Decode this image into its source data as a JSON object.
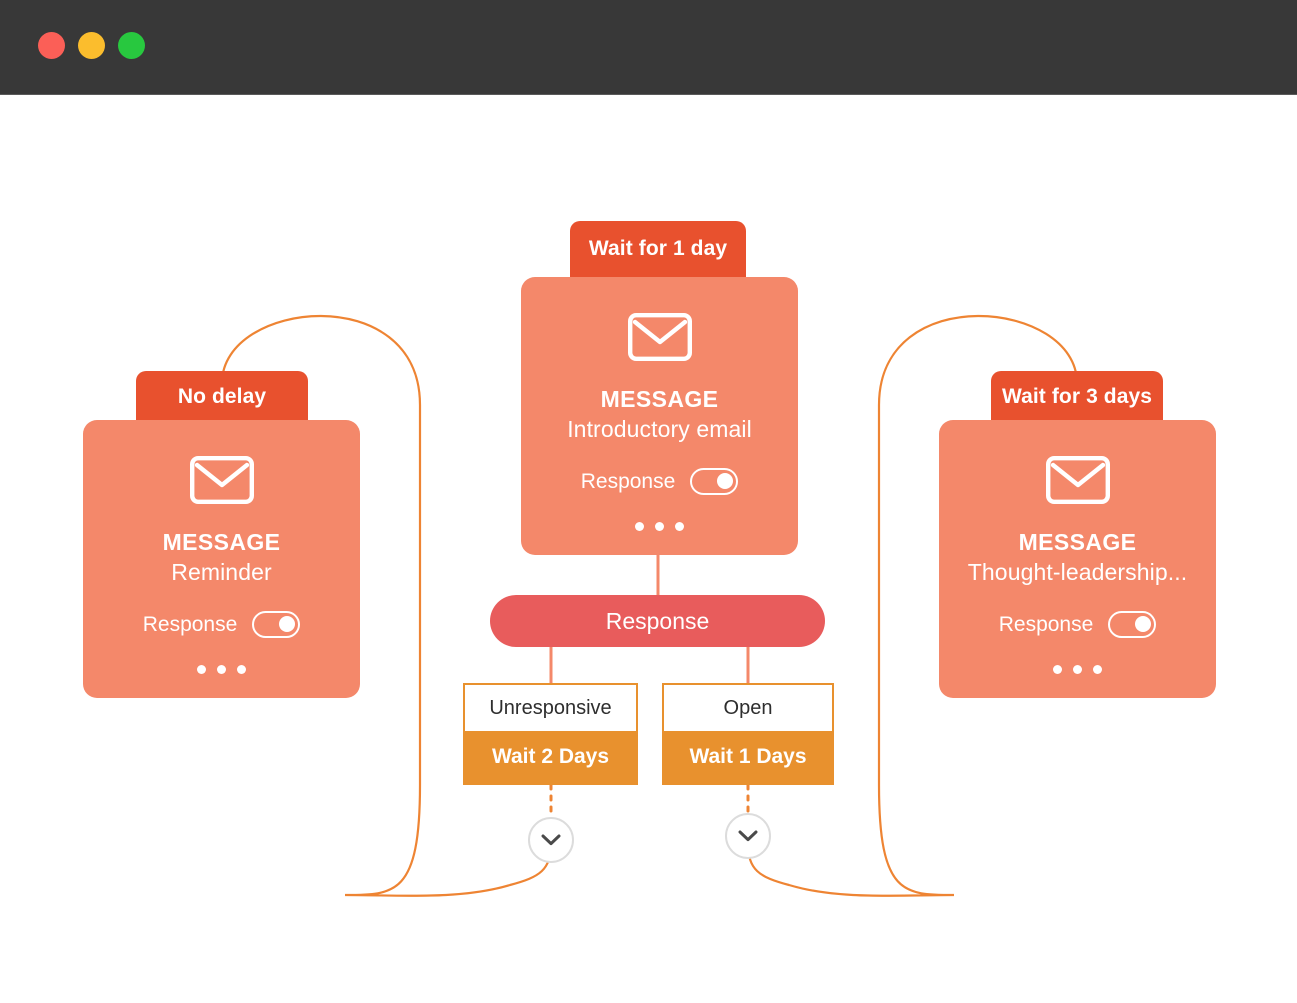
{
  "window": {
    "traffic_lights": [
      {
        "name": "close",
        "color": "#fb5f57"
      },
      {
        "name": "minimize",
        "color": "#fbbd2d"
      },
      {
        "name": "zoom",
        "color": "#28c83f"
      }
    ]
  },
  "theme": {
    "badge_color": "#e8512e",
    "card_color": "#f4886a",
    "response_color": "#e85c5c",
    "branch_color": "#e8912e",
    "edge_color": "#ee8433",
    "titlebar_color": "#383838"
  },
  "nodes": [
    {
      "id": "reminder",
      "badge": "No delay",
      "kind": "MESSAGE",
      "title": "Reminder",
      "response_label": "Response",
      "response_on": true,
      "icon": "envelope-icon",
      "menu_icon": "more-options-icon"
    },
    {
      "id": "introductory",
      "badge": "Wait for 1 day",
      "kind": "MESSAGE",
      "title": "Introductory email",
      "response_label": "Response",
      "response_on": true,
      "icon": "envelope-icon",
      "menu_icon": "more-options-icon"
    },
    {
      "id": "thought-leadership",
      "badge": "Wait for 3 days",
      "kind": "MESSAGE",
      "title": "Thought-leadership...",
      "response_label": "Response",
      "response_on": true,
      "icon": "envelope-icon",
      "menu_icon": "more-options-icon"
    }
  ],
  "response_pill": {
    "label": "Response"
  },
  "branches": [
    {
      "id": "unresponsive",
      "condition": "Unresponsive",
      "action": "Wait 2 Days"
    },
    {
      "id": "open",
      "condition": "Open",
      "action": "Wait 1 Days"
    }
  ],
  "expand_buttons": [
    {
      "id": "expand-unresponsive",
      "icon": "chevron-down-icon"
    },
    {
      "id": "expand-open",
      "icon": "chevron-down-icon"
    }
  ]
}
